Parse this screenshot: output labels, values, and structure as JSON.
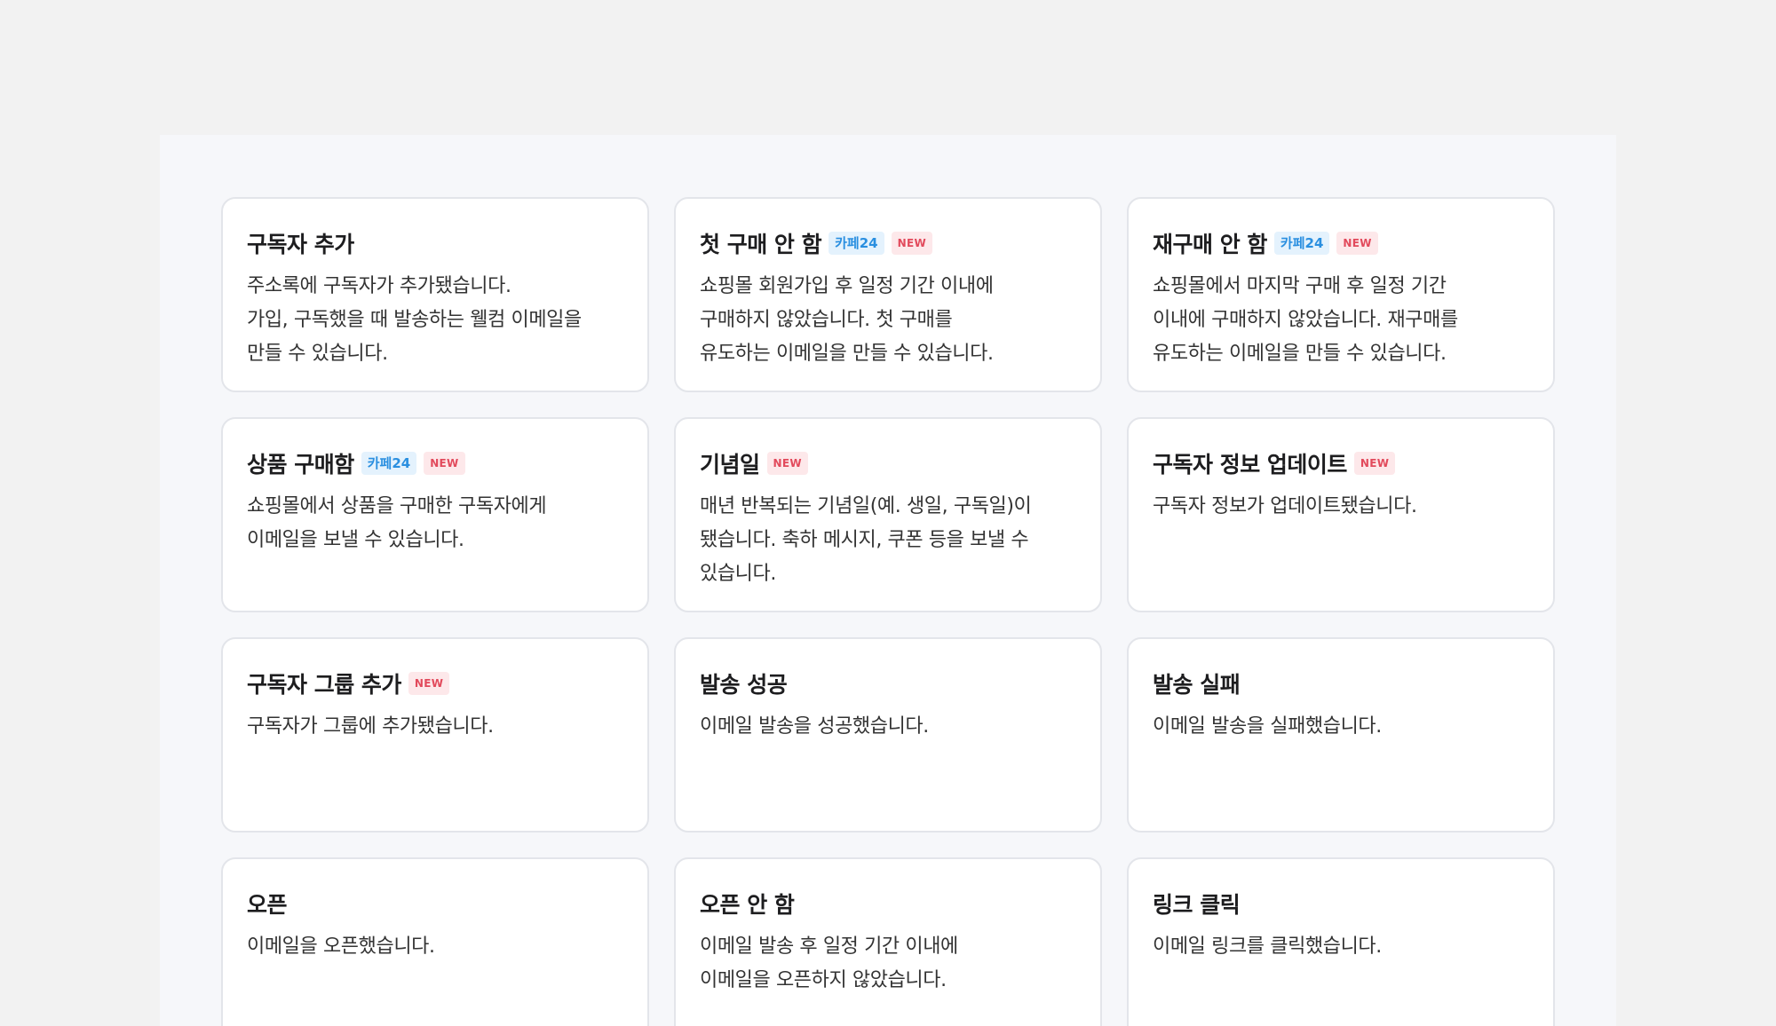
{
  "colors": {
    "page_background": "#f2f2f2",
    "panel_background": "#f6f7fa",
    "card_background": "#ffffff",
    "card_border": "#e3e5ea",
    "cafe24_badge_text": "#2a8fe0",
    "cafe24_badge_bg": "#e4f2fd",
    "new_badge_text": "#e24a5c",
    "new_badge_bg": "#fde8ea"
  },
  "badges": {
    "cafe24": "카페24",
    "new": "NEW"
  },
  "triggers": [
    {
      "title": "구독자 추가",
      "badges": [],
      "description": "주소록에 구독자가 추가됐습니다.\n가입, 구독했을 때 발송하는 웰컴 이메일을\n만들 수 있습니다."
    },
    {
      "title": "첫 구매 안 함",
      "badges": [
        "카페24",
        "NEW"
      ],
      "description": "쇼핑몰 회원가입 후 일정 기간 이내에\n구매하지 않았습니다. 첫 구매를\n유도하는 이메일을 만들 수 있습니다."
    },
    {
      "title": "재구매 안 함",
      "badges": [
        "카페24",
        "NEW"
      ],
      "description": "쇼핑몰에서 마지막 구매 후 일정 기간\n이내에 구매하지 않았습니다. 재구매를\n유도하는 이메일을 만들 수 있습니다."
    },
    {
      "title": "상품 구매함",
      "badges": [
        "카페24",
        "NEW"
      ],
      "description": "쇼핑몰에서 상품을 구매한 구독자에게\n이메일을 보낼 수 있습니다."
    },
    {
      "title": "기념일",
      "badges": [
        "NEW"
      ],
      "description": "매년 반복되는 기념일(예. 생일, 구독일)이\n됐습니다. 축하 메시지, 쿠폰 등을 보낼 수\n있습니다."
    },
    {
      "title": "구독자 정보 업데이트",
      "badges": [
        "NEW"
      ],
      "description": "구독자 정보가 업데이트됐습니다."
    },
    {
      "title": "구독자 그룹 추가",
      "badges": [
        "NEW"
      ],
      "description": "구독자가 그룹에 추가됐습니다."
    },
    {
      "title": "발송 성공",
      "badges": [],
      "description": "이메일 발송을 성공했습니다."
    },
    {
      "title": "발송 실패",
      "badges": [],
      "description": "이메일 발송을 실패했습니다."
    },
    {
      "title": "오픈",
      "badges": [],
      "description": "이메일을 오픈했습니다."
    },
    {
      "title": "오픈 안 함",
      "badges": [],
      "description": "이메일 발송 후 일정 기간 이내에\n이메일을 오픈하지 않았습니다."
    },
    {
      "title": "링크 클릭",
      "badges": [],
      "description": "이메일 링크를 클릭했습니다."
    }
  ]
}
